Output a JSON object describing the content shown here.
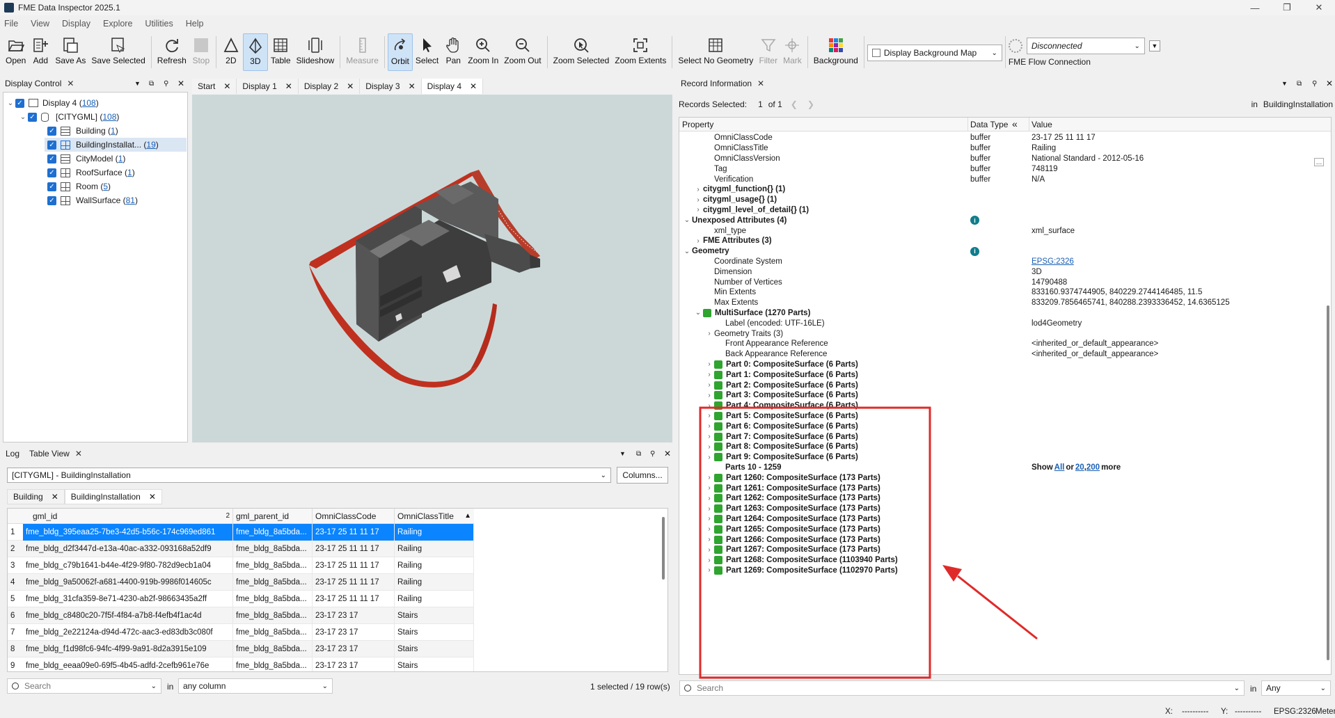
{
  "window": {
    "title": "FME Data Inspector 2025.1"
  },
  "menu": [
    "File",
    "View",
    "Display",
    "Explore",
    "Utilities",
    "Help"
  ],
  "toolbar": {
    "open": "Open",
    "add": "Add",
    "save_as": "Save As",
    "save_selected": "Save Selected",
    "refresh": "Refresh",
    "stop": "Stop",
    "2d": "2D",
    "3d": "3D",
    "table": "Table",
    "slideshow": "Slideshow",
    "measure": "Measure",
    "orbit": "Orbit",
    "select": "Select",
    "pan": "Pan",
    "zoom_in": "Zoom In",
    "zoom_out": "Zoom Out",
    "zoom_selected": "Zoom Selected",
    "zoom_extents": "Zoom Extents",
    "select_no_geometry": "Select No Geometry",
    "filter": "Filter",
    "mark": "Mark",
    "background": "Background",
    "background_map": "Display Background Map",
    "flow_status": "Disconnected",
    "flow_label": "FME Flow Connection"
  },
  "display_control": {
    "title": "Display Control",
    "tree": [
      {
        "label": "Display 4 (",
        "count": "108",
        "end": ")"
      },
      {
        "label": "[CITYGML] (",
        "count": "108",
        "end": ")"
      },
      {
        "label": "Building (",
        "count": "1",
        "end": ")"
      },
      {
        "label": "BuildingInstallat... (",
        "count": "19",
        "end": ")"
      },
      {
        "label": "CityModel (",
        "count": "1",
        "end": ")"
      },
      {
        "label": "RoofSurface (",
        "count": "1",
        "end": ")"
      },
      {
        "label": "Room (",
        "count": "5",
        "end": ")"
      },
      {
        "label": "WallSurface (",
        "count": "81",
        "end": ")"
      }
    ]
  },
  "view_tabs": [
    "Start",
    "Display 1",
    "Display 2",
    "Display 3",
    "Display 4"
  ],
  "bottom": {
    "tabs": [
      "Log",
      "Table View"
    ],
    "dataset": "[CITYGML] - BuildingInstallation",
    "columns_btn": "Columns...",
    "subtabs": [
      "Building",
      "BuildingInstallation"
    ],
    "headers": [
      "gml_id",
      "gml_parent_id",
      "OmniClassCode",
      "OmniClassTitle"
    ],
    "sort_marker": "2",
    "rows": [
      [
        "1",
        "fme_bldg_395eaa25-7be3-42d5-b56c-174c969ed861",
        "fme_bldg_8a5bda...",
        "23-17 25 11 11 17",
        "Railing"
      ],
      [
        "2",
        "fme_bldg_d2f3447d-e13a-40ac-a332-093168a52df9",
        "fme_bldg_8a5bda...",
        "23-17 25 11 11 17",
        "Railing"
      ],
      [
        "3",
        "fme_bldg_c79b1641-b44e-4f29-9f80-782d9ecb1a04",
        "fme_bldg_8a5bda...",
        "23-17 25 11 11 17",
        "Railing"
      ],
      [
        "4",
        "fme_bldg_9a50062f-a681-4400-919b-9986f014605c",
        "fme_bldg_8a5bda...",
        "23-17 25 11 11 17",
        "Railing"
      ],
      [
        "5",
        "fme_bldg_31cfa359-8e71-4230-ab2f-98663435a2ff",
        "fme_bldg_8a5bda...",
        "23-17 25 11 11 17",
        "Railing"
      ],
      [
        "6",
        "fme_bldg_c8480c20-7f5f-4f84-a7b8-f4efb4f1ac4d",
        "fme_bldg_8a5bda...",
        "23-17 23 17",
        "Stairs"
      ],
      [
        "7",
        "fme_bldg_2e22124a-d94d-472c-aac3-ed83db3c080f",
        "fme_bldg_8a5bda...",
        "23-17 23 17",
        "Stairs"
      ],
      [
        "8",
        "fme_bldg_f1d98fc6-94fc-4f99-9a91-8d2a3915e109",
        "fme_bldg_8a5bda...",
        "23-17 23 17",
        "Stairs"
      ],
      [
        "9",
        "fme_bldg_eeaa09e0-69f5-4b45-adfd-2cefb961e76e",
        "fme_bldg_8a5bda...",
        "23-17 23 17",
        "Stairs"
      ]
    ],
    "search_placeholder": "Search",
    "in_label": "in",
    "column_select": "any column",
    "status": "1 selected / 19 row(s)"
  },
  "record": {
    "title": "Record Information",
    "selected_label": "Records Selected:",
    "selected_value": "1",
    "of_label": "of 1",
    "in_label": "in",
    "in_value": "BuildingInstallation",
    "headers": {
      "property": "Property",
      "type": "Data Type",
      "value": "Value"
    },
    "rows": [
      {
        "indent": 2,
        "prop": "OmniClassCode",
        "type": "buffer",
        "value": "23-17 25 11 11 17"
      },
      {
        "indent": 2,
        "prop": "OmniClassTitle",
        "type": "buffer",
        "value": "Railing"
      },
      {
        "indent": 2,
        "prop": "OmniClassVersion",
        "type": "buffer",
        "value": "National Standard - 2012-05-16"
      },
      {
        "indent": 2,
        "prop": "Tag",
        "type": "buffer",
        "value": "748119"
      },
      {
        "indent": 2,
        "prop": "Verification",
        "type": "buffer",
        "value": "N/A"
      },
      {
        "indent": 1,
        "chev": "›",
        "prop": "citygml_function{} (1)",
        "bold": true
      },
      {
        "indent": 1,
        "chev": "›",
        "prop": "citygml_usage{} (1)",
        "bold": true
      },
      {
        "indent": 1,
        "chev": "›",
        "prop": "citygml_level_of_detail{} (1)",
        "bold": true
      },
      {
        "indent": 0,
        "chev": "⌄",
        "prop": "Unexposed Attributes (4)",
        "bold": true,
        "info": true
      },
      {
        "indent": 2,
        "prop": "xml_type",
        "type": "",
        "value": "xml_surface"
      },
      {
        "indent": 1,
        "chev": "›",
        "prop": "FME Attributes (3)",
        "bold": true
      },
      {
        "indent": 0,
        "chev": "⌄",
        "prop": "Geometry",
        "bold": true,
        "info": true
      },
      {
        "indent": 2,
        "prop": "Coordinate System",
        "type": "",
        "value": "EPSG:2326",
        "link": true
      },
      {
        "indent": 2,
        "prop": "Dimension",
        "type": "",
        "value": "3D"
      },
      {
        "indent": 2,
        "prop": "Number of Vertices",
        "type": "",
        "value": "14790488"
      },
      {
        "indent": 2,
        "prop": "Min Extents",
        "type": "",
        "value": "833160.9374744905, 840229.2744146485, 11.5"
      },
      {
        "indent": 2,
        "prop": "Max Extents",
        "type": "",
        "value": "833209.7856465741, 840288.2393336452, 14.6365125"
      },
      {
        "indent": 1,
        "chev": "⌄",
        "prop": "MultiSurface (1270 Parts)",
        "bold": true,
        "gicon": true
      },
      {
        "indent": 3,
        "prop": "Label (encoded: UTF-16LE)",
        "type": "",
        "value": "lod4Geometry"
      },
      {
        "indent": 2,
        "chev": "›",
        "prop": "Geometry Traits (3)"
      },
      {
        "indent": 3,
        "prop": "Front Appearance Reference",
        "type": "",
        "value": "<inherited_or_default_appearance>"
      },
      {
        "indent": 3,
        "prop": "Back Appearance Reference",
        "type": "",
        "value": "<inherited_or_default_appearance>"
      },
      {
        "indent": 2,
        "chev": "›",
        "prop": "Part 0: CompositeSurface (6 Parts)",
        "bold": true,
        "gicon": true
      },
      {
        "indent": 2,
        "chev": "›",
        "prop": "Part 1: CompositeSurface (6 Parts)",
        "bold": true,
        "gicon": true
      },
      {
        "indent": 2,
        "chev": "›",
        "prop": "Part 2: CompositeSurface (6 Parts)",
        "bold": true,
        "gicon": true
      },
      {
        "indent": 2,
        "chev": "›",
        "prop": "Part 3: CompositeSurface (6 Parts)",
        "bold": true,
        "gicon": true
      },
      {
        "indent": 2,
        "chev": "›",
        "prop": "Part 4: CompositeSurface (6 Parts)",
        "bold": true,
        "gicon": true
      },
      {
        "indent": 2,
        "chev": "›",
        "prop": "Part 5: CompositeSurface (6 Parts)",
        "bold": true,
        "gicon": true
      },
      {
        "indent": 2,
        "chev": "›",
        "prop": "Part 6: CompositeSurface (6 Parts)",
        "bold": true,
        "gicon": true
      },
      {
        "indent": 2,
        "chev": "›",
        "prop": "Part 7: CompositeSurface (6 Parts)",
        "bold": true,
        "gicon": true
      },
      {
        "indent": 2,
        "chev": "›",
        "prop": "Part 8: CompositeSurface (6 Parts)",
        "bold": true,
        "gicon": true
      },
      {
        "indent": 2,
        "chev": "›",
        "prop": "Part 9: CompositeSurface (6 Parts)",
        "bold": true,
        "gicon": true
      },
      {
        "indent": 3,
        "prop": "Parts 10 - 1259",
        "bold": true,
        "more": true
      },
      {
        "indent": 2,
        "chev": "›",
        "prop": "Part 1260: CompositeSurface (173 Parts)",
        "bold": true,
        "gicon": true
      },
      {
        "indent": 2,
        "chev": "›",
        "prop": "Part 1261: CompositeSurface (173 Parts)",
        "bold": true,
        "gicon": true
      },
      {
        "indent": 2,
        "chev": "›",
        "prop": "Part 1262: CompositeSurface (173 Parts)",
        "bold": true,
        "gicon": true
      },
      {
        "indent": 2,
        "chev": "›",
        "prop": "Part 1263: CompositeSurface (173 Parts)",
        "bold": true,
        "gicon": true
      },
      {
        "indent": 2,
        "chev": "›",
        "prop": "Part 1264: CompositeSurface (173 Parts)",
        "bold": true,
        "gicon": true
      },
      {
        "indent": 2,
        "chev": "›",
        "prop": "Part 1265: CompositeSurface (173 Parts)",
        "bold": true,
        "gicon": true
      },
      {
        "indent": 2,
        "chev": "›",
        "prop": "Part 1266: CompositeSurface (173 Parts)",
        "bold": true,
        "gicon": true
      },
      {
        "indent": 2,
        "chev": "›",
        "prop": "Part 1267: CompositeSurface (173 Parts)",
        "bold": true,
        "gicon": true
      },
      {
        "indent": 2,
        "chev": "›",
        "prop": "Part 1268: CompositeSurface (1103940 Parts)",
        "bold": true,
        "gicon": true
      },
      {
        "indent": 2,
        "chev": "›",
        "prop": "Part 1269: CompositeSurface (1102970 Parts)",
        "bold": true,
        "gicon": true
      }
    ],
    "show_more": {
      "show": "Show",
      "all": "All",
      "or": "or",
      "n20": "20",
      "comma": ",",
      "n200": "200",
      "more": "more"
    },
    "search_placeholder": "Search",
    "in_select": "Any"
  },
  "statusbar": {
    "x_label": "X:",
    "x_value": "----------",
    "y_label": "Y:",
    "y_value": "----------",
    "crs": "EPSG:2326",
    "units": "Meter"
  },
  "colors": {
    "accent": "#1e6fd0",
    "highlight": "#e02a2a",
    "selection": "#0a84ff",
    "viewport": "#ccd8d8"
  }
}
